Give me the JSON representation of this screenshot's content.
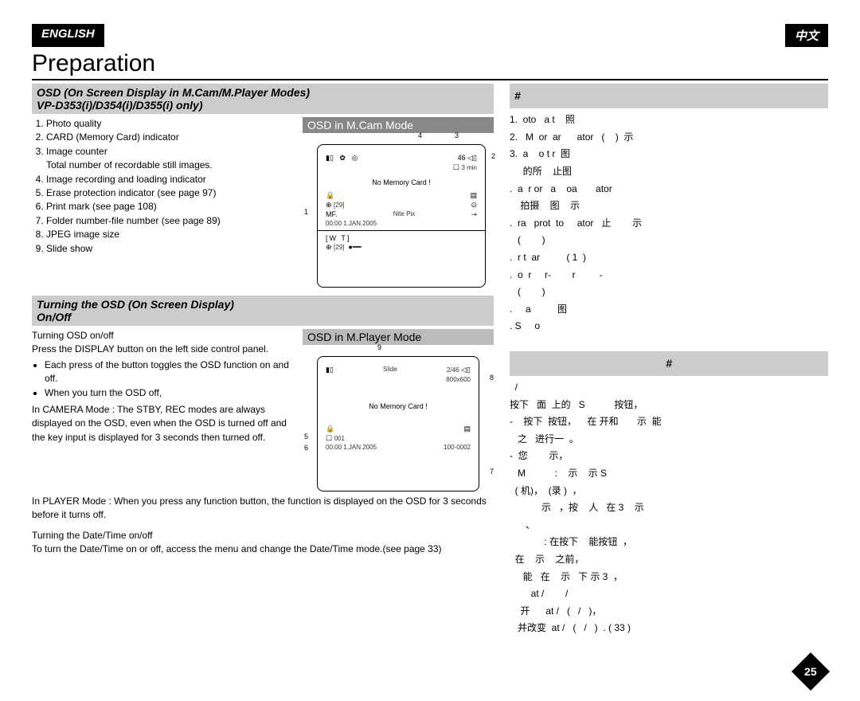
{
  "lang": {
    "left": "ENGLISH",
    "right": "中文"
  },
  "title": "Preparation",
  "sec1_head_line1": "OSD (On Screen Display in M.Cam/M.Player Modes)",
  "sec1_head_line2": "VP-D353(i)/D354(i)/D355(i) only)",
  "sec1_right_hash": "#",
  "list1": [
    "Photo quality",
    "CARD (Memory Card) indicator",
    "Image counter",
    "Total number of recordable still images.",
    "Image recording and loading indicator",
    "Erase protection indicator (see page 97)",
    "Print mark (see page 108)",
    "Folder number-file number (see page 89)",
    "JPEG image size",
    "Slide show"
  ],
  "diag1_title": "OSD in M.Cam Mode",
  "diag1": {
    "top_right": "46",
    "time": "3 min",
    "no_card": "No Memory Card !",
    "nite": "Nite Pix",
    "date": "00:00  1.JAN.2005",
    "wt": "W        T",
    "sp29a": "[29]",
    "sp29b": "[29]",
    "callouts": {
      "c1": "1",
      "c2": "2",
      "c3": "3",
      "c4": "4"
    }
  },
  "sec2_head_line1": "Turning the OSD (On Screen Display)",
  "sec2_head_line2": "On/Off",
  "sec2_right_hash": "#",
  "para2": {
    "t1": "Turning OSD on/off",
    "t2": "Press the DISPLAY button on the left side control panel.",
    "b1": "Each press of the button toggles the OSD function on and off.",
    "b2": "When you turn the OSD off,",
    "b3": "In CAMERA Mode : The STBY, REC modes are always displayed on the OSD, even when the OSD is turned off and the key input is displayed for 3 seconds then turned off.",
    "b4": "In PLAYER Mode : When you press any function button, the function is displayed on the OSD for 3 seconds before it turns off.",
    "t3": "Turning the Date/Time on/off",
    "t4": "To turn the Date/Time on or off, access the menu and change the Date/Time mode.(see page 33)"
  },
  "diag2_title": "OSD in M.Player Mode",
  "diag2": {
    "slide": "Slide",
    "count": "2/46",
    "res": "800x600",
    "no_card": "No Memory Card !",
    "folder": "001",
    "date": "00:00  1.JAN.2005",
    "file": "100-0002",
    "callouts": {
      "c5": "5",
      "c6": "6",
      "c7": "7",
      "c8": "8",
      "c9": "9"
    }
  },
  "cn_list1": [
    "1.  oto   a t    照",
    "2.   M  or  ar      ator   (    )  示",
    "3.  a    o t r  图",
    "     的所    止图",
    ".  a  r or   a    oa       ator",
    "    拍摄    图    示",
    ".  ra   prot  to     ator   止        示",
    "   (        )",
    ".  r t  ar          ( 1  )",
    ".  o  r     r-        r         -",
    "   (        )",
    ".     a          图",
    ". S     o"
  ],
  "cn_sec2_lines": [
    "  /",
    "按下   面  上的   S           按钮，",
    "-    按下  按钮，    在 开和       示  能",
    "   之   进行一  。",
    "-  您        示，",
    "   M           :    示    示 S",
    "  ( 机)，  (录 )  ，",
    "            示   ，按    人   在 3    示",
    "      、",
    "             : 在按下    能按钮  ，",
    "  在    示    之前，",
    "     能   在    示   下 示 3  ，",
    "        at /        /",
    "    开      at /   (   /   )，",
    "   并改变  at /   (   /   )  . ( 33 )"
  ],
  "page_number": "25"
}
